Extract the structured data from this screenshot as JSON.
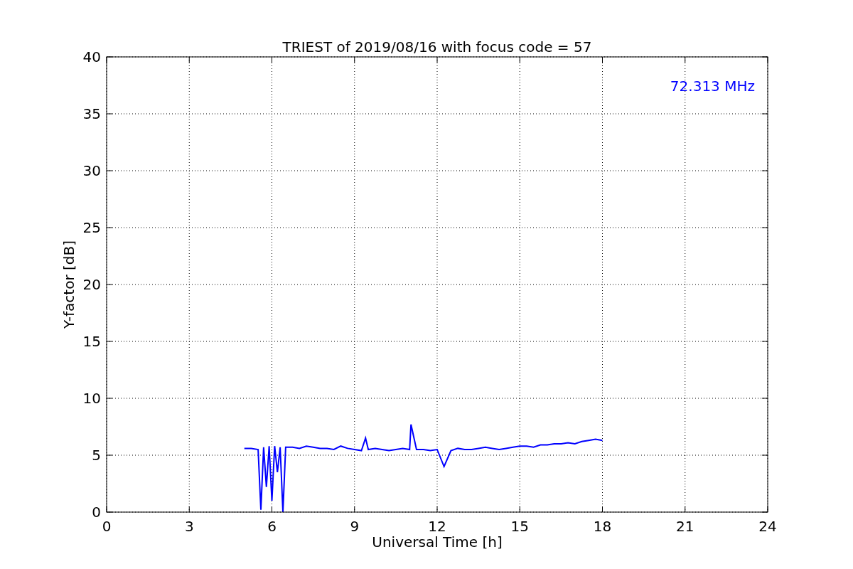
{
  "figure": {
    "chart_data": {
      "type": "line",
      "title": "TRIEST of 2019/08/16 with focus code = 57",
      "xlabel": "Universal Time [h]",
      "ylabel": "Y-factor [dB]",
      "x": [
        5,
        5.25,
        5.5,
        5.6,
        5.7,
        5.8,
        5.9,
        6.0,
        6.1,
        6.2,
        6.3,
        6.4,
        6.5,
        6.75,
        7,
        7.25,
        7.5,
        7.75,
        8,
        8.25,
        8.5,
        8.75,
        9,
        9.25,
        9.4,
        9.5,
        9.75,
        10,
        10.25,
        10.5,
        10.75,
        11,
        11.05,
        11.25,
        11.5,
        11.75,
        12,
        12.25,
        12.5,
        12.75,
        13,
        13.25,
        13.5,
        13.75,
        14,
        14.25,
        14.5,
        14.75,
        15,
        15.25,
        15.5,
        15.75,
        16,
        16.25,
        16.5,
        16.75,
        17,
        17.25,
        17.5,
        17.75,
        18
      ],
      "series": [
        {
          "name": "72.313 MHz",
          "color": "#0000ff",
          "values": [
            5.6,
            5.6,
            5.5,
            0.2,
            5.7,
            2.2,
            5.8,
            1.0,
            5.8,
            3.5,
            5.7,
            0.0,
            5.7,
            5.7,
            5.6,
            5.8,
            5.7,
            5.6,
            5.6,
            5.5,
            5.8,
            5.6,
            5.5,
            5.4,
            6.5,
            5.5,
            5.6,
            5.5,
            5.4,
            5.5,
            5.6,
            5.5,
            7.7,
            5.5,
            5.5,
            5.4,
            5.5,
            4.0,
            5.4,
            5.6,
            5.5,
            5.5,
            5.6,
            5.7,
            5.6,
            5.5,
            5.6,
            5.7,
            5.8,
            5.8,
            5.7,
            5.9,
            5.9,
            6.0,
            6.0,
            6.1,
            6.0,
            6.2,
            6.3,
            6.4,
            6.3
          ]
        }
      ],
      "xlim": [
        0,
        24
      ],
      "ylim": [
        0,
        40
      ],
      "xticks": [
        0,
        3,
        6,
        9,
        12,
        15,
        18,
        21,
        24
      ],
      "yticks": [
        0,
        5,
        10,
        15,
        20,
        25,
        30,
        35,
        40
      ],
      "grid": true
    }
  }
}
